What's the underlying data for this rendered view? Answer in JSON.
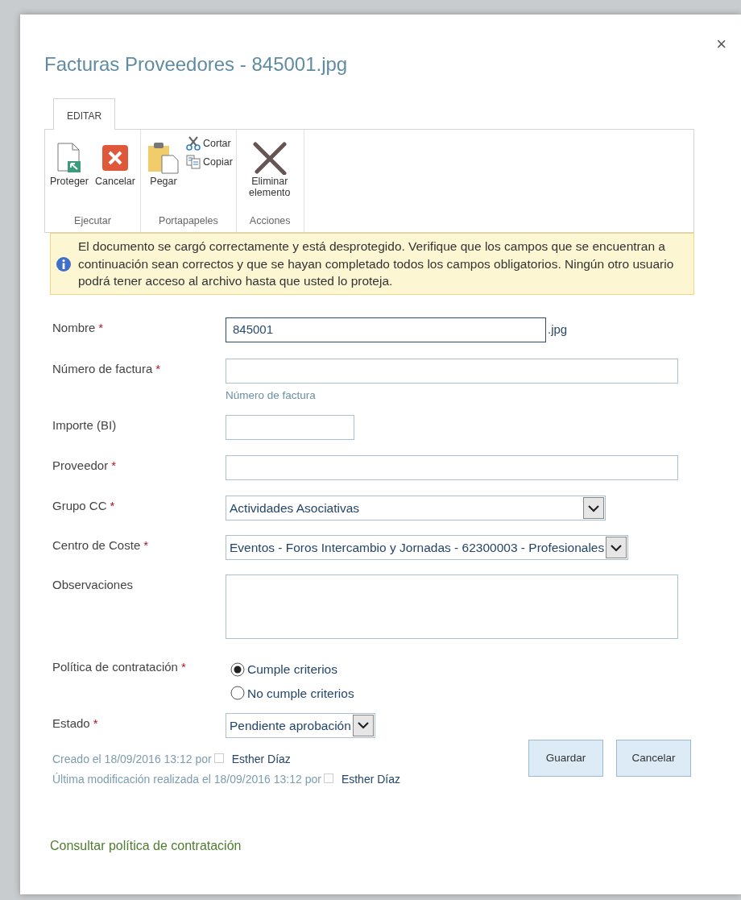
{
  "dialog": {
    "title": "Facturas Proveedores - 845001.jpg",
    "close": "×"
  },
  "ribbon": {
    "tabs": [
      {
        "label": "EDITAR",
        "selected": true
      }
    ],
    "groups": [
      {
        "label": "Ejecutar",
        "commands": [
          {
            "label": "Proteger",
            "kind": "large"
          },
          {
            "label": "Cancelar",
            "kind": "large"
          }
        ]
      },
      {
        "label": "Portapapeles",
        "commands": [
          {
            "label": "Pegar",
            "kind": "large"
          },
          {
            "label": "Cortar",
            "kind": "small"
          },
          {
            "label": "Copiar",
            "kind": "small"
          }
        ]
      },
      {
        "label": "Acciones",
        "commands": [
          {
            "label": "Eliminar elemento",
            "kind": "large"
          }
        ]
      }
    ]
  },
  "message": {
    "text": "El documento se cargó correctamente y está desprotegido. Verifique que los campos que se encuentran a continuación sean correctos y que se hayan completado todos los campos obligatorios. Ningún otro usuario podrá tener acceso al archivo hasta que usted lo proteja."
  },
  "fields": [
    {
      "label": "Nombre",
      "required_mark": "*",
      "kind": "text",
      "value": "845001",
      "suffix": ".jpg",
      "focused": true
    },
    {
      "label": "Número de factura",
      "required_mark": "*",
      "kind": "text",
      "hint": "Número de factura"
    },
    {
      "label": "Importe (BI)",
      "kind": "short"
    },
    {
      "label": "Proveedor",
      "required_mark": "*",
      "kind": "text"
    },
    {
      "label": "Grupo CC",
      "required_mark": "*",
      "kind": "select",
      "value": "Actividades Asociativas"
    },
    {
      "label": "Centro de Coste",
      "required_mark": "*",
      "kind": "select",
      "value": "Eventos - Foros Intercambio y Jornadas - 62300003 - Profesionales"
    },
    {
      "label": "Observaciones",
      "kind": "textarea"
    },
    {
      "label": "Política de contratación",
      "required_mark": "*",
      "kind": "radio",
      "options": [
        {
          "label": "Cumple criterios",
          "selected": true
        },
        {
          "label": "No cumple criterios",
          "selected": false
        }
      ]
    },
    {
      "label": "Estado",
      "required_mark": "*",
      "kind": "select",
      "value": "Pendiente aprobación"
    }
  ],
  "footer": {
    "lines": [
      {
        "text": "Creado el 18/09/2016 13:12  por",
        "user": "Esther Díaz"
      },
      {
        "text": "Última modificación realizada el 18/09/2016 13:12  por",
        "user": "Esther Díaz"
      }
    ],
    "buttons": [
      "Guardar",
      "Cancelar"
    ]
  },
  "link": "Consultar política de contratación"
}
